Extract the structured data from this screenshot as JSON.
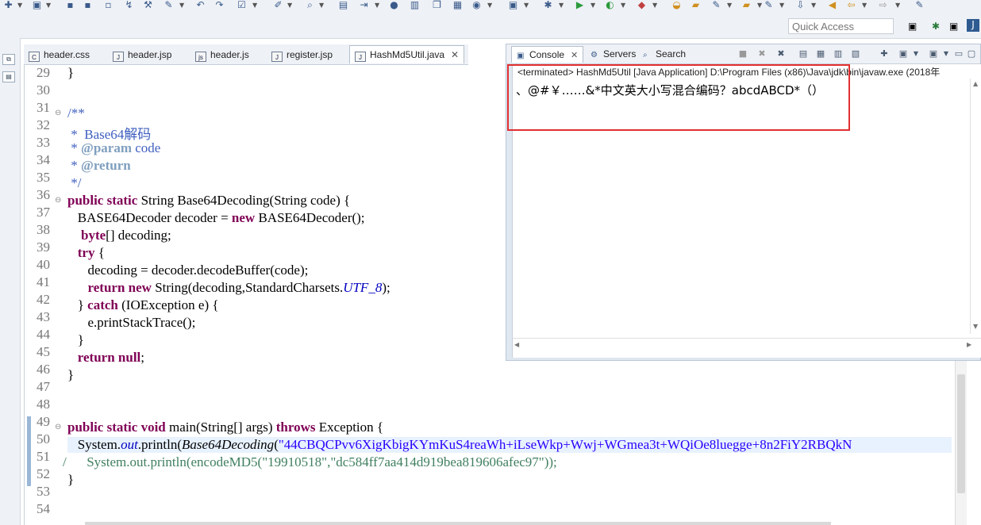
{
  "quick_access": {
    "placeholder": "Quick Access"
  },
  "editor_tabs": [
    {
      "label": "header.css"
    },
    {
      "label": "header.jsp"
    },
    {
      "label": "header.js"
    },
    {
      "label": "register.jsp"
    },
    {
      "label": "HashMd5Util.java",
      "close": "✕"
    }
  ],
  "console_tabs": [
    {
      "label": "Console"
    },
    {
      "label": "Servers"
    },
    {
      "label": "Search"
    }
  ],
  "console": {
    "terminated": "<terminated> HashMd5Util [Java Application] D:\\Program Files (x86)\\Java\\jdk\\bin\\javaw.exe (2018年",
    "output": "、@#￥……&*中文英大小写混合编码？abcdABCD*（）"
  },
  "code": {
    "lines": [
      "29",
      "30",
      "31",
      "32",
      "33",
      "34",
      "35",
      "36",
      "37",
      "38",
      "39",
      "40",
      "41",
      "42",
      "43",
      "44",
      "45",
      "46",
      "47",
      "48",
      "49",
      "50",
      "51",
      "52",
      "53",
      "54"
    ],
    "l29": "}",
    "l31": "/**",
    "l32_a": " *  ",
    "l32_b": "Base64解码",
    "l33_a": " * ",
    "l33_b": "@param",
    "l33_c": " code",
    "l34_a": " * ",
    "l34_b": "@return",
    "l35": " */",
    "l36_a": "public",
    "l36_b": " ",
    "l36_c": "static",
    "l36_d": " String Base64Decoding(String code) {",
    "l37_a": "   BASE64Decoder decoder = ",
    "l37_b": "new",
    "l37_c": " BASE64Decoder();",
    "l38_a": "    ",
    "l38_b": "byte",
    "l38_c": "[] decoding;",
    "l39_a": "   ",
    "l39_b": "try",
    "l39_c": " {",
    "l40": "      decoding = decoder.decodeBuffer(code);",
    "l41_a": "      ",
    "l41_b": "return",
    "l41_c": " ",
    "l41_d": "new",
    "l41_e": " String(decoding,StandardCharsets.",
    "l41_f": "UTF_8",
    "l41_g": ");",
    "l42_a": "   } ",
    "l42_b": "catch",
    "l42_c": " (IOException e) {",
    "l43": "      e.printStackTrace();",
    "l44": "   }",
    "l45_a": "   ",
    "l45_b": "return",
    "l45_c": " ",
    "l45_d": "null",
    "l45_e": ";",
    "l46": "}",
    "l49_a": "public",
    "l49_b": " ",
    "l49_c": "static",
    "l49_d": " ",
    "l49_e": "void",
    "l49_f": " main(String[] args) ",
    "l49_g": "throws",
    "l49_h": " Exception {",
    "l50_a": "   System.",
    "l50_b": "out",
    "l50_c": ".println(",
    "l50_d": "Base64Decoding",
    "l50_e": "(",
    "l50_f": "\"44CBQCPvv6XigKbigKYmKuS4reaWh+iLseWkp+Wwj+WGmea3t+WQiOe8luegge+8n2FiY2RBQkN",
    "l51": "/      System.out.println(encodeMD5(\"19910518\",\"dc584ff7aa414d919bea819606afec97\"));",
    "l52": "}"
  }
}
